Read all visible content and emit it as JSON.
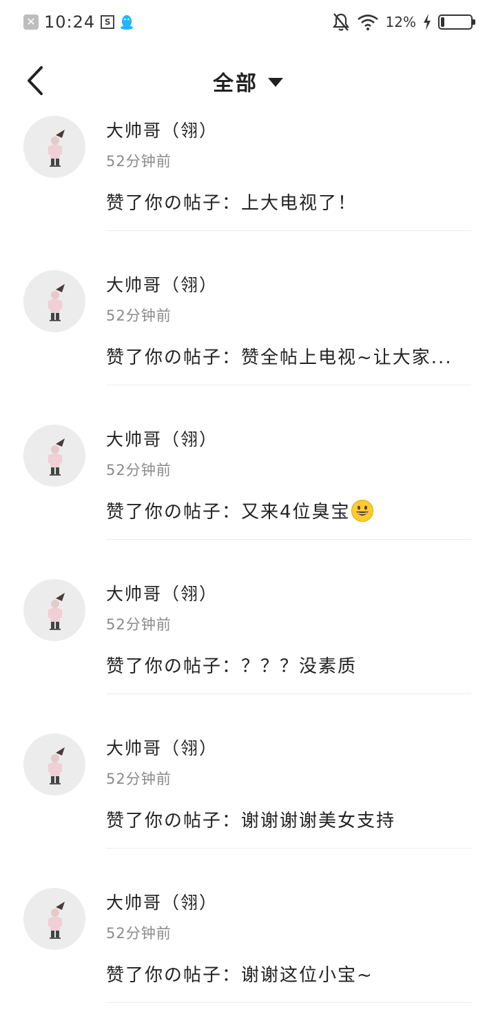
{
  "status_bar": {
    "time": "10:24",
    "notification_icon": "close-box-icon",
    "sim_icon": "sim-icon",
    "qq_icon": "qq-penguin-icon",
    "mute_icon": "bell-off-icon",
    "wifi_icon": "wifi-icon",
    "battery_percent_label": "12%",
    "battery_level": 0.12,
    "charging_icon": "lightning-icon"
  },
  "header": {
    "back_icon": "chevron-left-icon",
    "title": "全部",
    "dropdown_icon": "triangle-down-icon"
  },
  "items": [
    {
      "name": "大帅哥（翎）",
      "time": "52分钟前",
      "content": "赞了你の帖子：上大电视了！"
    },
    {
      "name": "大帅哥（翎）",
      "time": "52分钟前",
      "content": "赞了你の帖子：赞全帖上电视~让大家..."
    },
    {
      "name": "大帅哥（翎）",
      "time": "52分钟前",
      "content": "赞了你の帖子：又来4位臭宝",
      "emoji": "grinning-face-emoji"
    },
    {
      "name": "大帅哥（翎）",
      "time": "52分钟前",
      "content": "赞了你の帖子：？？？没素质"
    },
    {
      "name": "大帅哥（翎）",
      "time": "52分钟前",
      "content": "赞了你の帖子：谢谢谢谢美女支持"
    },
    {
      "name": "大帅哥（翎）",
      "time": "52分钟前",
      "content": "赞了你の帖子：谢谢这位小宝~"
    }
  ]
}
